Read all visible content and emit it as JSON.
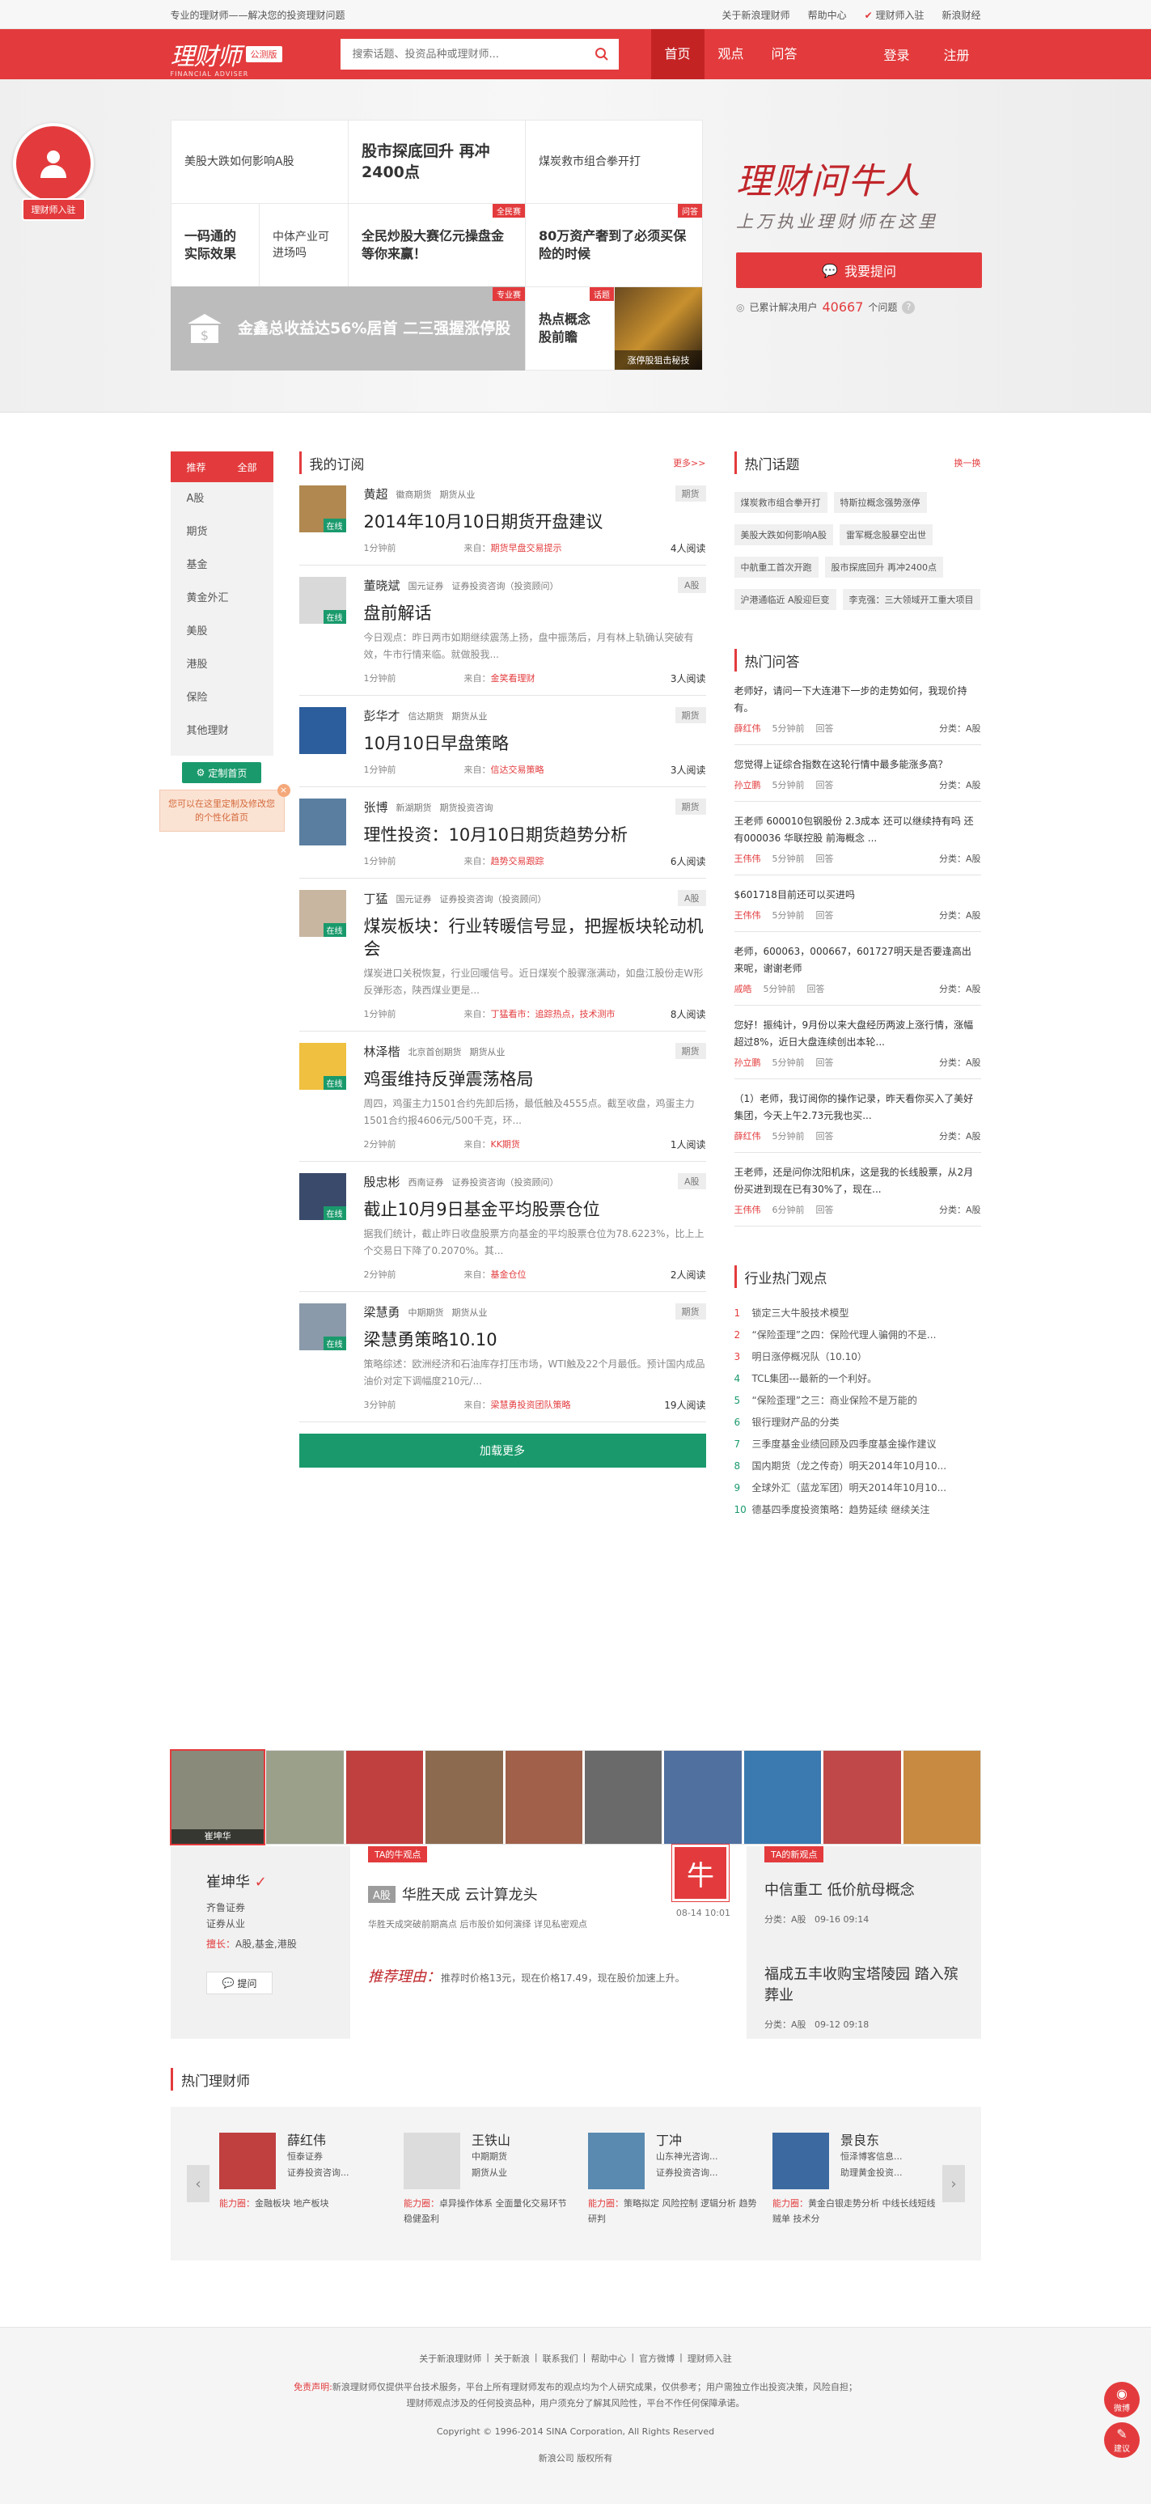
{
  "topbar": {
    "slogan": "专业的理财师——解决您的投资理财问题",
    "links": [
      "关于新浪理财师",
      "帮助中心",
      "理财师入驻",
      "新浪财经"
    ]
  },
  "header": {
    "logo": "理财师",
    "logo_sub": "FINANCIAL ADVISER",
    "badge": "公测版",
    "search_placeholder": "搜索话题、投资品种或理财师...",
    "nav": [
      "首页",
      "观点",
      "问答"
    ],
    "login": "登录",
    "register": "注册"
  },
  "banner": {
    "join_label": "理财师入驻",
    "cells": [
      {
        "text": "美股大跌如何影响A股",
        "tag": ""
      },
      {
        "text": "股市探底回升 再冲2400点",
        "tag": ""
      },
      {
        "text": "煤炭救市组合拳开打",
        "tag": ""
      },
      {
        "text": "一码通的实际效果",
        "tag": ""
      },
      {
        "text": "中体产业可进场吗",
        "tag": ""
      },
      {
        "text": "全民炒股大赛亿元操盘金等你来赢！",
        "tag": "全民赛"
      },
      {
        "text": "80万资产奢到了必须买保险的时候",
        "tag": "问答"
      },
      {
        "text": "金鑫总收益达56%居首 二三强握涨停股",
        "tag": "专业赛"
      },
      {
        "text": "热点概念股前瞻",
        "tag": "话题"
      },
      {
        "text": "涨停股狙击秘技",
        "tag": ""
      }
    ],
    "slogan": "理财问牛人",
    "slogan2": "上万执业理财师在这里",
    "ask_button": "我要提问",
    "stat_prefix": "已累计解决用户",
    "stat_value": "40667",
    "stat_suffix": "个问题"
  },
  "leftnav": {
    "head": "推荐",
    "all": "全部",
    "items": [
      "A股",
      "期货",
      "基金",
      "黄金外汇",
      "美股",
      "港股",
      "保险",
      "其他理财"
    ],
    "custom": "定制首页",
    "tip": "您可以在这里定制及修改您的个性化首页"
  },
  "feed": {
    "title": "我的订阅",
    "more": "更多>>",
    "src_label": "来自：",
    "load_more": "加载更多",
    "entries": [
      {
        "name": "黄超",
        "org": "徽商期货",
        "role": "期货从业",
        "cat": "期货",
        "title": "2014年10月10日期货开盘建议",
        "desc": "",
        "time": "1分钟前",
        "src": "期货早盘交易提示",
        "reads": "4人阅读",
        "online": "在线"
      },
      {
        "name": "董晓斌",
        "org": "国元证券",
        "role": "证券投资咨询（投资顾问）",
        "cat": "A股",
        "title": "盘前解话",
        "desc": "今日观点：昨日两市如期继续震荡上扬，盘中振荡后，月有林上轨确认突破有效，牛市行情来临。就做股我...",
        "time": "1分钟前",
        "src": "金笑看理财",
        "reads": "3人阅读",
        "online": "在线"
      },
      {
        "name": "彭华才",
        "org": "信达期货",
        "role": "期货从业",
        "cat": "期货",
        "title": "10月10日早盘策略",
        "desc": "",
        "time": "1分钟前",
        "src": "信达交易策略",
        "reads": "3人阅读",
        "online": ""
      },
      {
        "name": "张博",
        "org": "新湖期货",
        "role": "期货投资咨询",
        "cat": "期货",
        "title": "理性投资：10月10日期货趋势分析",
        "desc": "",
        "time": "1分钟前",
        "src": "趋势交易跟踪",
        "reads": "6人阅读",
        "online": ""
      },
      {
        "name": "丁猛",
        "org": "国元证券",
        "role": "证券投资咨询（投资顾问）",
        "cat": "A股",
        "title": "煤炭板块：行业转暖信号显，把握板块轮动机会",
        "desc": "煤炭进口关税恢复，行业回暖信号。近日煤炭个股骤涨满动，如盘江股份走W形反弹形态，陕西煤业更是...",
        "time": "1分钟前",
        "src": "丁猛看市：追踪热点，技术测市",
        "reads": "8人阅读",
        "online": "在线"
      },
      {
        "name": "林泽楷",
        "org": "北京首创期货",
        "role": "期货从业",
        "cat": "期货",
        "title": "鸡蛋维持反弹震荡格局",
        "desc": "周四，鸡蛋主力1501合约先卸后扬，最低触及4555点。截至收盘，鸡蛋主力1501合约报4606元/500千克，环...",
        "time": "2分钟前",
        "src": "KK期货",
        "reads": "1人阅读",
        "online": "在线"
      },
      {
        "name": "殷忠彬",
        "org": "西南证券",
        "role": "证券投资咨询（投资顾问）",
        "cat": "A股",
        "title": "截止10月9日基金平均股票仓位",
        "desc": "据我们统计，截止昨日收盘股票方向基金的平均股票仓位为78.6223%，比上上个交易日下降了0.2070%。其...",
        "time": "2分钟前",
        "src": "基金仓位",
        "reads": "2人阅读",
        "online": "在线"
      },
      {
        "name": "梁慧勇",
        "org": "中期期货",
        "role": "期货从业",
        "cat": "期货",
        "title": "梁慧勇策略10.10",
        "desc": "策略综述：欧洲经济和石油库存打压市场，WTI触及22个月最低。预计国内成品油价对定下调幅度210元/...",
        "time": "3分钟前",
        "src": "梁慧勇投资团队策略",
        "reads": "19人阅读",
        "online": "在线"
      }
    ]
  },
  "side": {
    "topics_title": "热门话题",
    "topics_more": "换一换",
    "topics": [
      "煤炭救市组合拳开打",
      "特斯拉概念强势涨停",
      "美股大跌如何影响A股",
      "雷军概念股暴空出世",
      "中航重工首次开跑",
      "股市探底回升 再冲2400点",
      "沪港通临近 A股迎巨变",
      "李克强：三大领域开工重大项目"
    ],
    "qa_title": "热门问答",
    "answered": "回答",
    "qa": [
      {
        "q": "老师好，请问一下大连港下一步的走势如何，我现价持有。",
        "name": "薛红伟",
        "time": "5分钟前",
        "cat": "分类：A股"
      },
      {
        "q": "您觉得上证综合指数在这轮行情中最多能涨多高？",
        "name": "孙立鹏",
        "time": "5分钟前",
        "cat": "分类：A股"
      },
      {
        "q": "王老师 600010包钢股份 2.3成本 还可以继续持有吗 还有000036 华联控股 前海概念 ...",
        "name": "王伟伟",
        "time": "5分钟前",
        "cat": "分类：A股"
      },
      {
        "q": "$601718目前还可以买进吗",
        "name": "王伟伟",
        "time": "5分钟前",
        "cat": "分类：A股"
      },
      {
        "q": "老师，600063，000667，601727明天是否要逢高出来呢，谢谢老师",
        "name": "戚皓",
        "time": "5分钟前",
        "cat": "分类：A股"
      },
      {
        "q": "您好！振纯计，9月份以来大盘经历两波上涨行情，涨幅超过8%，近日大盘连续创出本轮...",
        "name": "孙立鹏",
        "time": "5分钟前",
        "cat": "分类：A股"
      },
      {
        "q": "（1）老师，我订阅你的操作记录，昨天看你买入了美好集团，今天上午2.73元我也买...",
        "name": "薛红伟",
        "time": "5分钟前",
        "cat": "分类：A股"
      },
      {
        "q": "王老师，还是问你沈阳机床，这是我的长线股票，从2月份买进到现在已有30%了，现在...",
        "name": "王伟伟",
        "time": "6分钟前",
        "cat": "分类：A股"
      }
    ],
    "hot_title": "行业热门观点",
    "hot": [
      "锁定三大牛股技术模型",
      "“保险歪理”之四：保险代理人骗佣的不是...",
      "明日涨停概况队（10.10）",
      "TCL集团---最新的一个利好。",
      "“保险歪理”之三：商业保险不是万能的",
      "银行理财产品的分类",
      "三季度基金业绩回顾及四季度基金操作建议",
      "国内期货（龙之传奇）明天2014年10月10...",
      "全球外汇（蓝龙军团）明天2014年10月10...",
      "德基四季度投资策略：趋势延续 继续关注"
    ]
  },
  "experts": {
    "names": [
      "崔坤华",
      "",
      "",
      "",
      "",
      "",
      "",
      "",
      "",
      ""
    ],
    "selected": {
      "name": "崔坤华",
      "org": "齐鲁证券",
      "role": "证券从业",
      "good_label": "擅长：",
      "good": "A股,基金,港股",
      "ask": "提问"
    },
    "view_label": "TA的牛观点",
    "view_mark": "A股",
    "view_title": "华胜天成 云计算龙头",
    "seal": "牛",
    "view_date": "08-14 10:01",
    "view_desc": "华胜天成突破前期高点 后市股价如何演绎 详见私密观点",
    "reason_label": "推荐理由：",
    "reason": "推荐时价格13元，现在价格17.49，现在股价加速上升。",
    "new_label": "TA的新观点",
    "news": [
      {
        "title": "中信重工 低价航母概念",
        "cat": "分类：A股",
        "date": "09-16 09:14"
      },
      {
        "title": "福成五丰收购宝塔陵园 踏入殡葬业",
        "cat": "分类：A股",
        "date": "09-12 09:18"
      }
    ]
  },
  "hotadv": {
    "title": "热门理财师",
    "skill_label": "能力圈：",
    "list": [
      {
        "name": "薛红伟",
        "l1": "恒泰证券",
        "l2": "证券投资咨询...",
        "skill": "金融板块 地产板块"
      },
      {
        "name": "王铁山",
        "l1": "中期期货",
        "l2": "期货从业",
        "skill": "卓异操作体系 全面量化交易环节 稳健盈利"
      },
      {
        "name": "丁冲",
        "l1": "山东神光咨询...",
        "l2": "证券投资咨询...",
        "skill": "策略拟定 风险控制 逻辑分析 趋势研判"
      },
      {
        "name": "景良东",
        "l1": "恒泽博客信息...",
        "l2": "助理黄金投资...",
        "skill": "黄金白银走势分析 中线长线短线贼单 技术分"
      }
    ]
  },
  "footer": {
    "links": [
      "关于新浪理财师",
      "关于新浪",
      "联系我们",
      "帮助中心",
      "官方微博",
      "理财师入驻"
    ],
    "disclaimer_label": "免责声明:",
    "disclaimer": "新浪理财师仅提供平台技术服务，平台上所有理财师发布的观点均为个人研究成果，仅供参考；用户需独立作出投资决策，风险自担；",
    "disclaimer2": "理财师观点涉及的任何投资品种，用户须充分了解其风险性，平台不作任何保障承诺。",
    "copyright": "Copyright © 1996-2014 SINA Corporation, All Rights Reserved",
    "bottom": "新浪公司  版权所有",
    "float": [
      "微博",
      "建议"
    ]
  }
}
